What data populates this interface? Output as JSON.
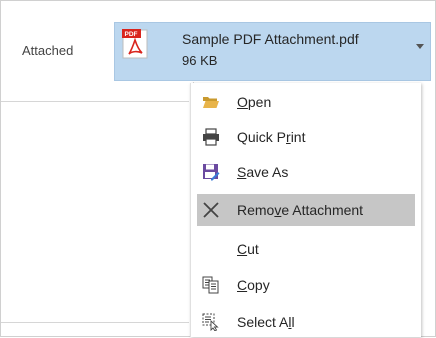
{
  "attached_label": "Attached",
  "attachment": {
    "file_icon": "pdf-icon",
    "icon_badge_text": "PDF",
    "name": "Sample PDF Attachment.pdf",
    "size": "96 KB"
  },
  "menu": {
    "items": [
      {
        "label_pre": "",
        "mnemonic": "O",
        "label_post": "pen",
        "icon": "folder-open-icon"
      },
      {
        "label_pre": "Quick P",
        "mnemonic": "r",
        "label_post": "int",
        "icon": "printer-icon"
      },
      {
        "label_pre": "",
        "mnemonic": "S",
        "label_post": "ave As",
        "icon": "save-as-icon"
      },
      {
        "label_pre": "Remo",
        "mnemonic": "v",
        "label_post": "e Attachment",
        "icon": "remove-x-icon"
      },
      {
        "label_pre": "",
        "mnemonic": "C",
        "label_post": "ut",
        "icon": ""
      },
      {
        "label_pre": "",
        "mnemonic": "C",
        "label_post": "opy",
        "icon": "copy-icon"
      },
      {
        "label_pre": "Select A",
        "mnemonic": "l",
        "label_post": "l",
        "icon": "select-all-icon"
      }
    ]
  },
  "colors": {
    "chip_bg": "#bcd7ef",
    "hover_bg": "#c6c6c6",
    "pdf_red": "#d9251d",
    "folder_yellow": "#e8b44a",
    "save_purple": "#6b4aa0"
  }
}
